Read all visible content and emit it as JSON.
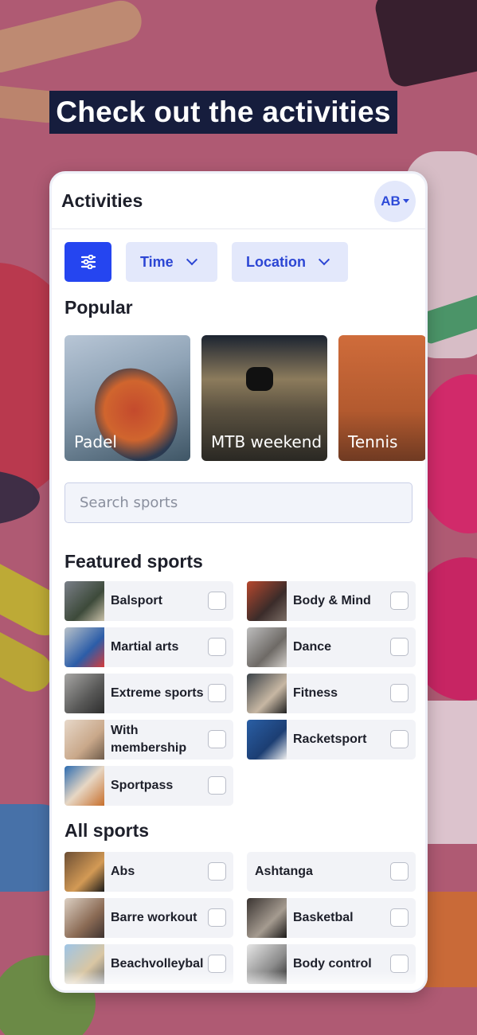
{
  "headline": "Check out the activities",
  "app": {
    "title": "Activities",
    "avatar_initials": "AB"
  },
  "filters": {
    "time_label": "Time",
    "location_label": "Location"
  },
  "popular": {
    "title": "Popular",
    "cards": [
      "Padel",
      "MTB weekend",
      "Tennis"
    ]
  },
  "search": {
    "placeholder": "Search sports"
  },
  "featured": {
    "title": "Featured sports",
    "items": [
      {
        "label": "Balsport",
        "checked": false
      },
      {
        "label": "Body & Mind",
        "checked": false
      },
      {
        "label": "Martial arts",
        "checked": false
      },
      {
        "label": "Dance",
        "checked": false
      },
      {
        "label": "Extreme sports",
        "checked": false
      },
      {
        "label": "Fitness",
        "checked": false
      },
      {
        "label": "With membership",
        "checked": false
      },
      {
        "label": "Racketsport",
        "checked": false
      },
      {
        "label": "Sportpass",
        "checked": false
      }
    ]
  },
  "all_sports": {
    "title": "All sports",
    "items": [
      {
        "label": "Abs",
        "checked": false
      },
      {
        "label": "Ashtanga",
        "checked": false
      },
      {
        "label": "Barre workout",
        "checked": false
      },
      {
        "label": "Basketbal",
        "checked": false
      },
      {
        "label": "Beachvolleybal",
        "checked": false
      },
      {
        "label": "Body control",
        "checked": false
      }
    ]
  },
  "colors": {
    "accent": "#2545f0",
    "accent_light": "#e3e8fb",
    "headline_bg": "#161d3d"
  }
}
